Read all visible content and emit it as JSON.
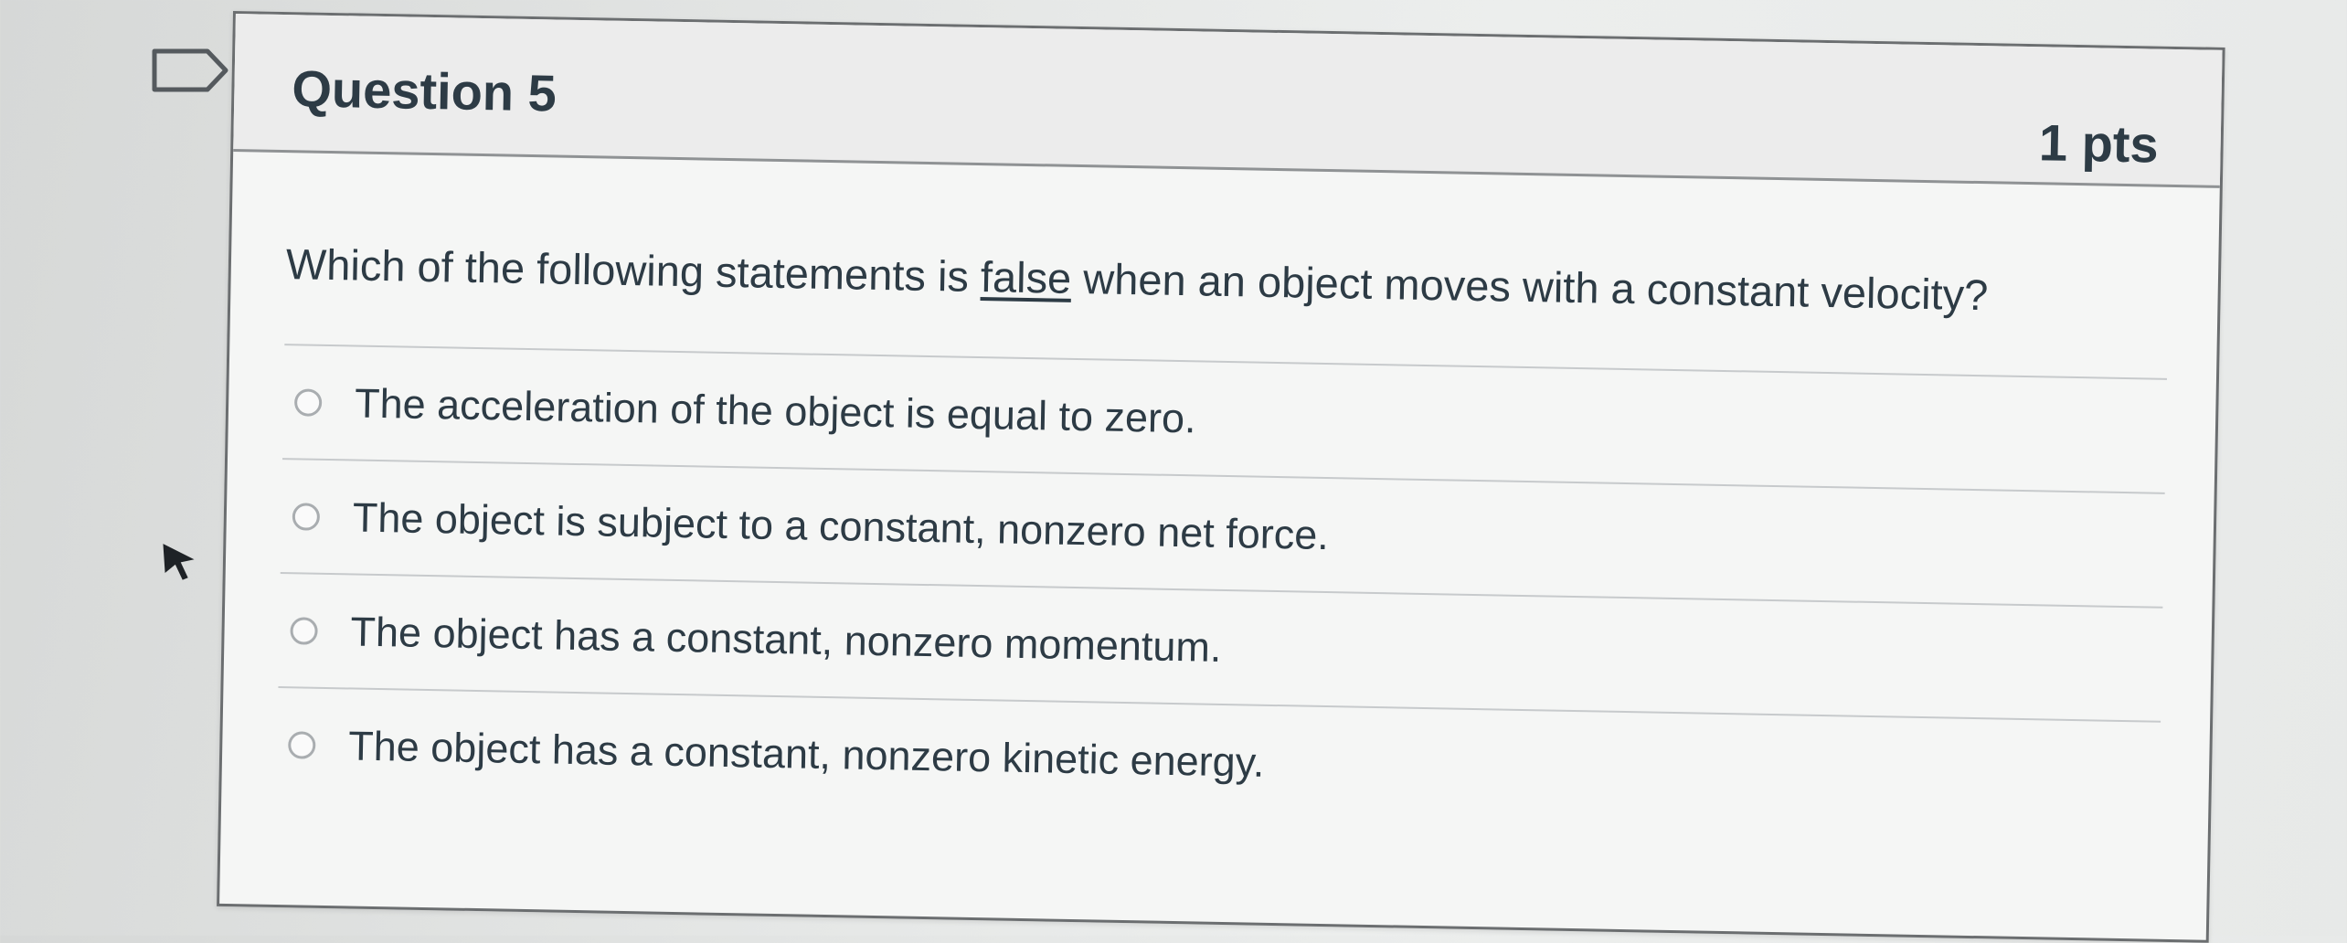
{
  "question": {
    "title": "Question 5",
    "points": "1 pts",
    "text_before": "Which of the following statements is ",
    "text_emphasis": "false",
    "text_after": " when an object moves with a constant velocity?"
  },
  "answers": [
    {
      "label": "The acceleration of the object is equal to zero.",
      "selected": false
    },
    {
      "label": "The object is subject to a constant, nonzero net force.",
      "selected": false
    },
    {
      "label": "The object has a constant, nonzero momentum.",
      "selected": false
    },
    {
      "label": "The object has a constant, nonzero kinetic energy.",
      "selected": false
    }
  ],
  "icons": {
    "flag": "bookmark-flag-icon",
    "cursor": "mouse-pointer-icon"
  },
  "colors": {
    "text": "#2d3b45",
    "border": "#6b6e70",
    "header_bg": "#ececec"
  }
}
